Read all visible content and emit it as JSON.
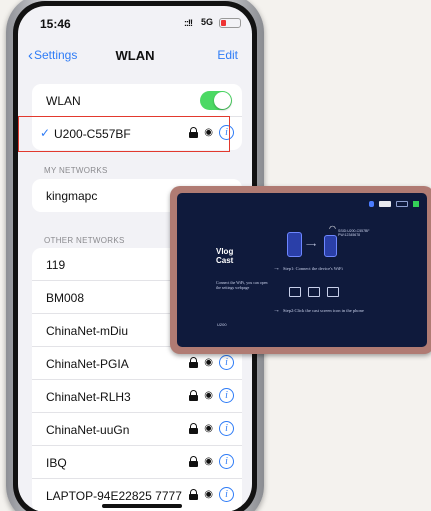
{
  "status_bar": {
    "time": "15:46",
    "signal": "::!!",
    "network": "5G",
    "battery_level": 0.25
  },
  "nav": {
    "back_label": "Settings",
    "title": "WLAN",
    "edit_label": "Edit"
  },
  "wlan": {
    "label": "WLAN",
    "enabled": true
  },
  "connected_network": {
    "name": "U200-C557BF",
    "secured": true
  },
  "sections": {
    "my_networks": "MY NETWORKS",
    "other_networks": "OTHER NETWORKS"
  },
  "my_networks": [
    {
      "name": "kingmapc"
    }
  ],
  "other_networks": [
    {
      "name": "119"
    },
    {
      "name": "BM008"
    },
    {
      "name": "ChinaNet-mDiu"
    },
    {
      "name": "ChinaNet-PGIA"
    },
    {
      "name": "ChinaNet-RLH3"
    },
    {
      "name": "ChinaNet-uuGn"
    },
    {
      "name": "IBQ"
    },
    {
      "name": "LAPTOP-94E22825 7777"
    }
  ],
  "tablet": {
    "title_line1": "Vlog",
    "title_line2": "Cast",
    "help_text": "Connect the WiFi, you can open the settings webpage",
    "model": "U200",
    "ssid_line1": "SSID:U200-C557BF",
    "ssid_line2": "PW:12345678",
    "step1": "Step1: Connect the device's WiFi",
    "step2": "Step2:Click the cast screen icon in the phone"
  },
  "colors": {
    "accent": "#2f7cf6",
    "toggle_on": "#4cd964",
    "highlight": "#e2392e",
    "tablet_bg": "#0f1a3c"
  }
}
